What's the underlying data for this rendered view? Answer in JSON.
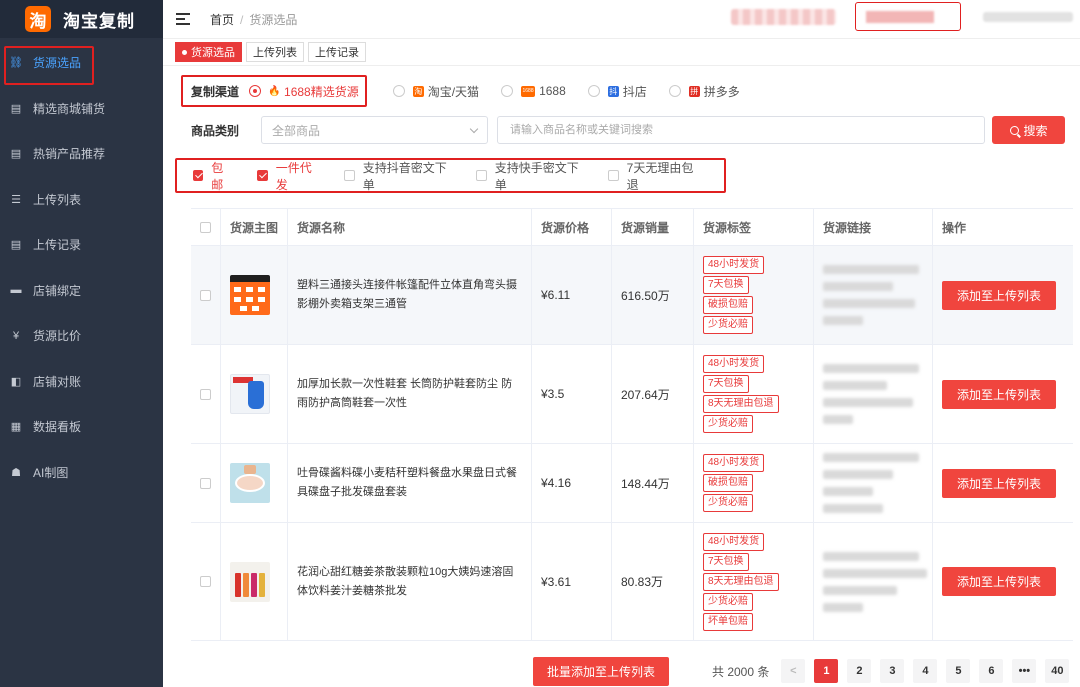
{
  "app": {
    "title": "淘宝复制",
    "logo_glyph": "淘"
  },
  "sidebar": {
    "items": [
      {
        "label": "货源选品",
        "icon": "sitemap-icon",
        "glyph": "⛓"
      },
      {
        "label": "精选商城铺货",
        "icon": "file-icon",
        "glyph": "▤"
      },
      {
        "label": "热销产品推荐",
        "icon": "file-icon",
        "glyph": "▤"
      },
      {
        "label": "上传列表",
        "icon": "list-icon",
        "glyph": "☰"
      },
      {
        "label": "上传记录",
        "icon": "file-icon",
        "glyph": "▤"
      },
      {
        "label": "店铺绑定",
        "icon": "lock-icon",
        "glyph": "▬"
      },
      {
        "label": "货源比价",
        "icon": "yen-icon",
        "glyph": "¥"
      },
      {
        "label": "店铺对账",
        "icon": "book-icon",
        "glyph": "◧"
      },
      {
        "label": "数据看板",
        "icon": "grid-icon",
        "glyph": "▦"
      },
      {
        "label": "AI制图",
        "icon": "robot-icon",
        "glyph": "☗"
      }
    ]
  },
  "header": {
    "crumb_home": "首页",
    "crumb_sep": "/",
    "crumb_current": "货源选品"
  },
  "tabs": [
    "货源选品",
    "上传列表",
    "上传记录"
  ],
  "filters": {
    "channel_label": "复制渠道",
    "channels": [
      {
        "label": "1688精选货源",
        "glyph": "🔥",
        "color": "#e83a3a"
      },
      {
        "label": "淘宝/天猫",
        "glyph": "淘",
        "color": "#ff6a00"
      },
      {
        "label": "1688",
        "glyph": "1688",
        "color": "#ff6a00"
      },
      {
        "label": "抖店",
        "glyph": "抖",
        "color": "#2d6ee0"
      },
      {
        "label": "拼多多",
        "glyph": "拼",
        "color": "#e02e24"
      }
    ],
    "category_label": "商品类别",
    "category_value": "全部商品",
    "search_placeholder": "请输入商品名称或关键词搜索",
    "search_button": "搜索",
    "checks": [
      {
        "label": "包邮",
        "checked": true
      },
      {
        "label": "一件代发",
        "checked": true
      },
      {
        "label": "支持抖音密文下单",
        "checked": false
      },
      {
        "label": "支持快手密文下单",
        "checked": false
      },
      {
        "label": "7天无理由包退",
        "checked": false
      }
    ]
  },
  "table": {
    "headers": [
      "货源主图",
      "货源名称",
      "货源价格",
      "货源销量",
      "货源标签",
      "货源链接",
      "操作"
    ],
    "rows": [
      {
        "name": "塑料三通接头连接件帐篷配件立体直角弯头摄影棚外卖箱支架三通管",
        "price": "¥6.11",
        "sales": "616.50万",
        "tags": [
          "48小时发货",
          "7天包换",
          "破损包赔",
          "少货必赔"
        ],
        "action": "添加至上传列表"
      },
      {
        "name": "加厚加长款一次性鞋套 长筒防护鞋套防尘 防雨防护高筒鞋套一次性",
        "price": "¥3.5",
        "sales": "207.64万",
        "tags": [
          "48小时发货",
          "7天包换",
          "8天无理由包退",
          "少货必赔"
        ],
        "action": "添加至上传列表"
      },
      {
        "name": "吐骨碟酱料碟小麦秸秆塑料餐盘水果盘日式餐具碟盘子批发碟盘套装",
        "price": "¥4.16",
        "sales": "148.44万",
        "tags": [
          "48小时发货",
          "破损包赔",
          "少货必赔"
        ],
        "action": "添加至上传列表"
      },
      {
        "name": "花润心甜红糖姜茶散装颗粒10g大姨妈速溶固体饮料姜汁姜糖茶批发",
        "price": "¥3.61",
        "sales": "80.83万",
        "tags": [
          "48小时发货",
          "7天包换",
          "8天无理由包退",
          "少货必赔",
          "坏单包赔"
        ],
        "action": "添加至上传列表"
      }
    ]
  },
  "pager": {
    "bulk_button": "批量添加至上传列表",
    "total": "共 2000 条",
    "prev": "<",
    "pages": [
      "1",
      "2",
      "3",
      "4",
      "5",
      "6",
      "•••",
      "40"
    ],
    "current": "1"
  }
}
